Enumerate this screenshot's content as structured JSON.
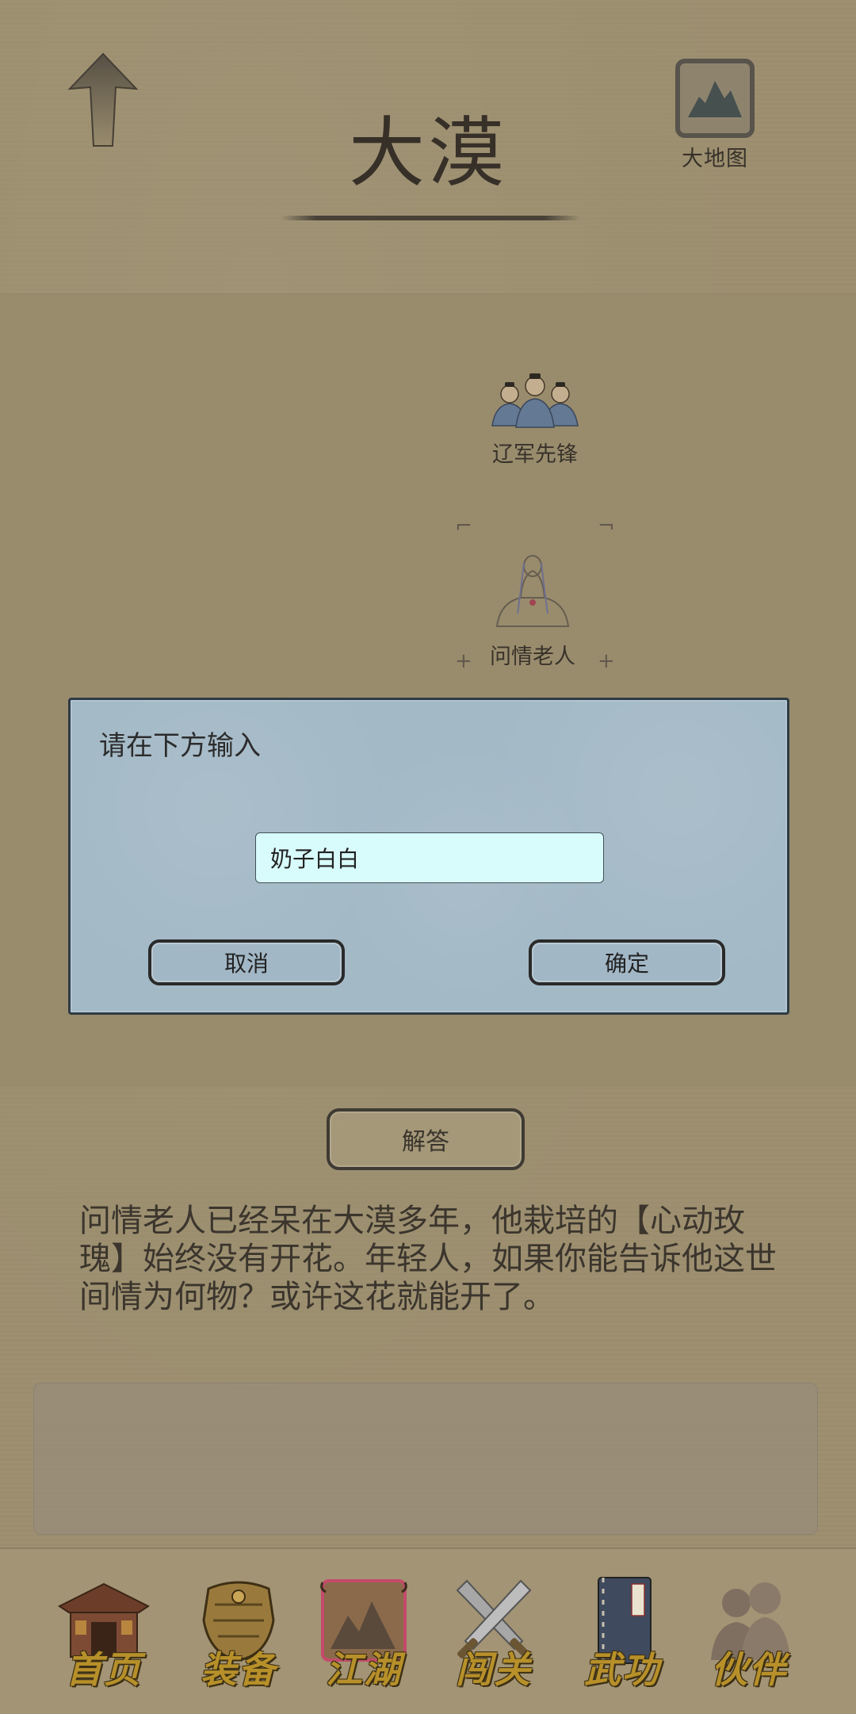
{
  "header": {
    "title": "大漠",
    "map_button_label": "大地图"
  },
  "map": {
    "npcs": [
      {
        "name": "辽军先锋"
      },
      {
        "name": "问情老人"
      }
    ]
  },
  "dialog": {
    "title": "请在下方输入",
    "input_value": "奶子白白",
    "cancel_label": "取消",
    "confirm_label": "确定"
  },
  "answer_button_label": "解答",
  "story_text": "问情老人已经呆在大漠多年，他栽培的【心动玫瑰】始终没有开花。年轻人，如果你能告诉他这世间情为何物？或许这花就能开了。",
  "bottom_nav": {
    "items": [
      {
        "label": "首页",
        "icon": "house-icon"
      },
      {
        "label": "装备",
        "icon": "armor-icon"
      },
      {
        "label": "江湖",
        "icon": "scroll-map-icon"
      },
      {
        "label": "闯关",
        "icon": "crossed-swords-icon"
      },
      {
        "label": "武功",
        "icon": "book-icon"
      },
      {
        "label": "伙伴",
        "icon": "partners-icon"
      }
    ],
    "active_index": 2
  },
  "colors": {
    "background": "#ad9f7c",
    "dialog_bg": "#a3b9c6",
    "input_bg": "#d8fbfb",
    "nav_label": "#b7902a"
  }
}
